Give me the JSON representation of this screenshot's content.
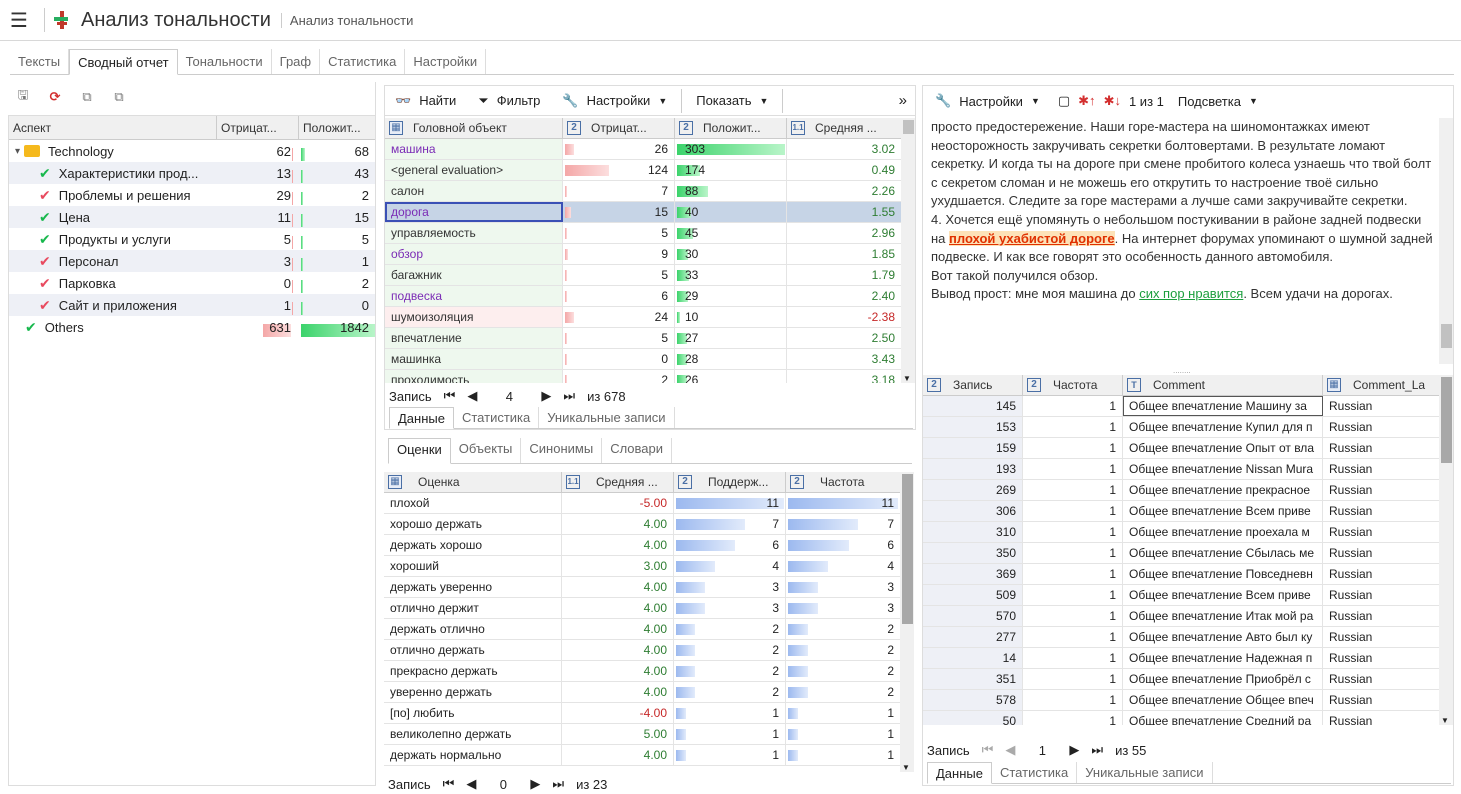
{
  "app": {
    "title": "Анализ тональности",
    "subtitle": "Анализ тональности"
  },
  "tabs": [
    "Тексты",
    "Сводный отчет",
    "Тональности",
    "Граф",
    "Статистика",
    "Настройки"
  ],
  "aspect": {
    "headers": [
      "Аспект",
      "Отрицат...",
      "Положит..."
    ],
    "rows": [
      {
        "label": "Technology",
        "neg": "62",
        "pos": "68",
        "neg_frac": 0.0,
        "pos_frac": 0.05,
        "type": "folder"
      },
      {
        "label": "Характеристики прод...",
        "neg": "13",
        "pos": "43",
        "neg_frac": 0.0,
        "pos_frac": 0.03,
        "type": "green"
      },
      {
        "label": "Проблемы и решения",
        "neg": "29",
        "pos": "2",
        "neg_frac": 0.0,
        "pos_frac": 0,
        "type": "red"
      },
      {
        "label": "Цена",
        "neg": "11",
        "pos": "15",
        "neg_frac": 0,
        "pos_frac": 0,
        "type": "green"
      },
      {
        "label": "Продукты и услуги",
        "neg": "5",
        "pos": "5",
        "neg_frac": 0,
        "pos_frac": 0,
        "type": "green"
      },
      {
        "label": "Персонал",
        "neg": "3",
        "pos": "1",
        "neg_frac": 0,
        "pos_frac": 0,
        "type": "red"
      },
      {
        "label": "Парковка",
        "neg": "0",
        "pos": "2",
        "neg_frac": 0,
        "pos_frac": 0,
        "type": "red"
      },
      {
        "label": "Сайт и приложения",
        "neg": "1",
        "pos": "0",
        "neg_frac": 0,
        "pos_frac": 0,
        "type": "red"
      },
      {
        "label": "Others",
        "neg": "631",
        "pos": "1842",
        "neg_frac": 0.34,
        "pos_frac": 1.0,
        "type": "green"
      }
    ]
  },
  "objects_toolbar": {
    "find": "Найти",
    "filter": "Фильтр",
    "settings": "Настройки",
    "show": "Показать"
  },
  "objects": {
    "headers": [
      "Головной объект",
      "Отрицат...",
      "Положит...",
      "Средняя ..."
    ],
    "rows": [
      {
        "name": "машина",
        "neg": "26",
        "pos": "303",
        "avg": "3.02",
        "neg_f": 0.08,
        "pos_f": 1.0,
        "c": "#7a2bb5",
        "bg": "#eef8ee"
      },
      {
        "name": "<general evaluation>",
        "neg": "124",
        "pos": "174",
        "avg": "0.49",
        "neg_f": 0.4,
        "pos_f": 0.21,
        "c": "#333",
        "bg": "#eef8ee"
      },
      {
        "name": "салон",
        "neg": "7",
        "pos": "88",
        "avg": "2.26",
        "neg_f": 0.02,
        "pos_f": 0.29,
        "c": "#333",
        "bg": "#eef8ee"
      },
      {
        "name": "дорога",
        "neg": "15",
        "pos": "40",
        "avg": "1.55",
        "neg_f": 0.05,
        "pos_f": 0.13,
        "c": "#7a2bb5",
        "bg": "#eef8ee",
        "sel": true
      },
      {
        "name": "управляемость",
        "neg": "5",
        "pos": "45",
        "avg": "2.96",
        "neg_f": 0.02,
        "pos_f": 0.15,
        "c": "#333",
        "bg": "#eef8ee"
      },
      {
        "name": "обзор",
        "neg": "9",
        "pos": "30",
        "avg": "1.85",
        "neg_f": 0.03,
        "pos_f": 0.1,
        "c": "#7a2bb5",
        "bg": "#eef8ee"
      },
      {
        "name": "багажник",
        "neg": "5",
        "pos": "33",
        "avg": "1.79",
        "neg_f": 0.02,
        "pos_f": 0.11,
        "c": "#333",
        "bg": "#eef8ee"
      },
      {
        "name": "подвеска",
        "neg": "6",
        "pos": "29",
        "avg": "2.40",
        "neg_f": 0.02,
        "pos_f": 0.1,
        "c": "#7a2bb5",
        "bg": "#eef8ee"
      },
      {
        "name": "шумоизоляция",
        "neg": "24",
        "pos": "10",
        "avg": "-2.38",
        "neg_f": 0.08,
        "pos_f": 0.03,
        "c": "#333",
        "bg": "#fdeeee"
      },
      {
        "name": "впечатление",
        "neg": "5",
        "pos": "27",
        "avg": "2.50",
        "neg_f": 0.02,
        "pos_f": 0.09,
        "c": "#333",
        "bg": "#eef8ee"
      },
      {
        "name": "машинка",
        "neg": "0",
        "pos": "28",
        "avg": "3.43",
        "neg_f": 0,
        "pos_f": 0.09,
        "c": "#333",
        "bg": "#eef8ee"
      },
      {
        "name": "проходимость",
        "neg": "2",
        "pos": "26",
        "avg": "3.18",
        "neg_f": 0.01,
        "pos_f": 0.09,
        "c": "#333",
        "bg": "#eef8ee"
      }
    ],
    "nav": {
      "label": "Запись",
      "current": "4",
      "total": "из 678"
    },
    "subtabs": [
      "Данные",
      "Статистика",
      "Уникальные записи"
    ]
  },
  "scores": {
    "tabs": [
      "Оценки",
      "Объекты",
      "Синонимы",
      "Словари"
    ],
    "headers": [
      "Оценка",
      "Средняя ...",
      "Поддерж...",
      "Частота"
    ],
    "rows": [
      {
        "name": "плохой",
        "avg": "-5.00",
        "sup": "11",
        "freq": "11",
        "f": 1.0
      },
      {
        "name": "хорошо держать",
        "avg": "4.00",
        "sup": "7",
        "freq": "7",
        "f": 0.64
      },
      {
        "name": "держать хорошо",
        "avg": "4.00",
        "sup": "6",
        "freq": "6",
        "f": 0.55
      },
      {
        "name": "хороший",
        "avg": "3.00",
        "sup": "4",
        "freq": "4",
        "f": 0.36
      },
      {
        "name": "держать уверенно",
        "avg": "4.00",
        "sup": "3",
        "freq": "3",
        "f": 0.27
      },
      {
        "name": "отлично держит",
        "avg": "4.00",
        "sup": "3",
        "freq": "3",
        "f": 0.27
      },
      {
        "name": "держать отлично",
        "avg": "4.00",
        "sup": "2",
        "freq": "2",
        "f": 0.18
      },
      {
        "name": "отлично держать",
        "avg": "4.00",
        "sup": "2",
        "freq": "2",
        "f": 0.18
      },
      {
        "name": "прекрасно держать",
        "avg": "4.00",
        "sup": "2",
        "freq": "2",
        "f": 0.18
      },
      {
        "name": "уверенно держать",
        "avg": "4.00",
        "sup": "2",
        "freq": "2",
        "f": 0.18
      },
      {
        "name": "[по] любить",
        "avg": "-4.00",
        "sup": "1",
        "freq": "1",
        "f": 0.09
      },
      {
        "name": "великолепно держать",
        "avg": "5.00",
        "sup": "1",
        "freq": "1",
        "f": 0.09
      },
      {
        "name": "держать нормально",
        "avg": "4.00",
        "sup": "1",
        "freq": "1",
        "f": 0.09
      }
    ],
    "nav": {
      "label": "Запись",
      "current": "0",
      "total": "из 23"
    }
  },
  "text_toolbar": {
    "settings": "Настройки",
    "counter": "1 из 1",
    "highlight": "Подсветка"
  },
  "text": {
    "p1": "просто предостережение. Наши горе-мастера на шиномонтажках имеют неосторожность закручивать секретки болтовертами. В результате ломают секретку. И когда ты на дороге при смене пробитого колеса узнаешь что твой болт с секретом сломан и не можешь его открутить то настроение твоё сильно ухудшается. Следите за горе мастерами а лучше сами закручивайте секретки.",
    "p2a": "4. Хочется ещё упомянуть о небольшом постукивании в районе задней подвески на ",
    "p2hl": "плохой ухабистой дороге",
    "p2b": ". На интернет форумах упоминают о шумной задней подвеске. И как все говорят это особенность данного автомобиля.",
    "p3": "Вот такой получился обзор.",
    "p4a": "Вывод прост: мне моя машина до ",
    "p4hl": "сих пор нравится",
    "p4b": ". Всем удачи на дорогах."
  },
  "records": {
    "headers": [
      "Запись",
      "Частота",
      "Comment",
      "Comment_La"
    ],
    "rows": [
      [
        "145",
        "1",
        "Общее впечатление Машину за",
        "Russian"
      ],
      [
        "153",
        "1",
        "Общее впечатление Купил для п",
        "Russian"
      ],
      [
        "159",
        "1",
        "Общее впечатление Опыт от вла",
        "Russian"
      ],
      [
        "193",
        "1",
        "Общее впечатление Nissan Mura",
        "Russian"
      ],
      [
        "269",
        "1",
        "Общее впечатление прекрасное",
        "Russian"
      ],
      [
        "306",
        "1",
        "Общее впечатление Всем приве",
        "Russian"
      ],
      [
        "310",
        "1",
        "Общее впечатление проехала м",
        "Russian"
      ],
      [
        "350",
        "1",
        "Общее впечатление Сбылась ме",
        "Russian"
      ],
      [
        "369",
        "1",
        "Общее впечатление Повседневн",
        "Russian"
      ],
      [
        "509",
        "1",
        "Общее впечатление Всем приве",
        "Russian"
      ],
      [
        "570",
        "1",
        "Общее впечатление Итак мой ра",
        "Russian"
      ],
      [
        "277",
        "1",
        "Общее впечатление Авто был ку",
        "Russian"
      ],
      [
        "14",
        "1",
        "Общее впечатление Надежная п",
        "Russian"
      ],
      [
        "351",
        "1",
        "Общее впечатление Приобрёл с",
        "Russian"
      ],
      [
        "578",
        "1",
        "Общее впечатление Общее впеч",
        "Russian"
      ],
      [
        "50",
        "1",
        "Общее впечатление Средний ра",
        "Russian"
      ]
    ],
    "nav": {
      "label": "Запись",
      "current": "1",
      "total": "из 55"
    },
    "subtabs": [
      "Данные",
      "Статистика",
      "Уникальные записи"
    ]
  }
}
